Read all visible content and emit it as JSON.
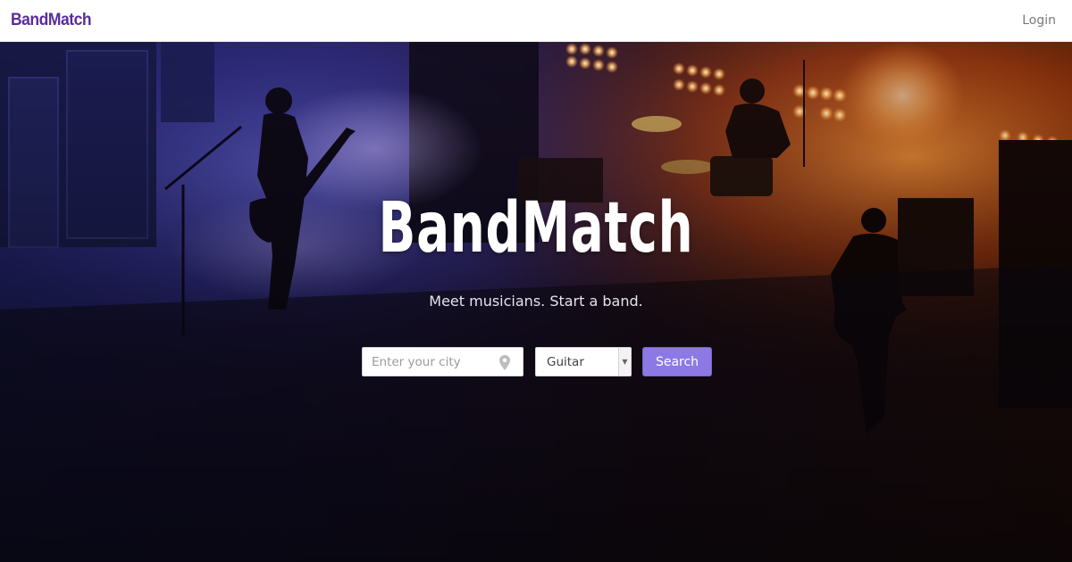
{
  "navbar": {
    "brand": "BandMatch",
    "login_label": "Login"
  },
  "hero": {
    "title": "BandMatch",
    "subtitle": "Meet musicians. Start a band.",
    "background": "concert stage photo with guitarists and drummer under purple and orange lights"
  },
  "search": {
    "city_placeholder": "Enter your city",
    "city_value": "",
    "instrument_selected": "Guitar",
    "button_label": "Search"
  },
  "colors": {
    "brand": "#5b2c9c",
    "button": "#8d79e4",
    "light_left": "#3f3aa0",
    "light_right": "#e8651c"
  },
  "icons": [
    "location-pin-icon",
    "chevron-down-icon"
  ]
}
